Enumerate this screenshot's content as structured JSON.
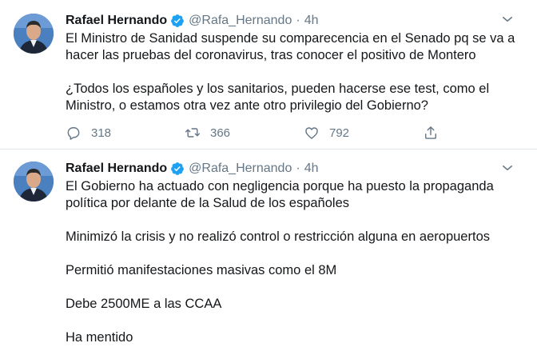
{
  "tweets": [
    {
      "name": "Rafael Hernando",
      "handle": "@Rafa_Hernando",
      "dot": "·",
      "time": "4h",
      "paragraphs": [
        "El Ministro de Sanidad suspende su comparecencia en el Senado pq se va a\nhacer las pruebas del coronavirus, tras conocer el positivo de Montero",
        "¿Todos los españoles y los sanitarios, pueden hacerse ese test, como el\nMinistro, o estamos otra vez ante otro privilegio del Gobierno?"
      ],
      "replies": "318",
      "retweets": "366",
      "likes": "792"
    },
    {
      "name": "Rafael Hernando",
      "handle": "@Rafa_Hernando",
      "dot": "·",
      "time": "4h",
      "paragraphs": [
        "El Gobierno ha actuado con negligencia porque ha puesto la propaganda\npolítica por delante de la Salud de los españoles",
        "Minimizó la crisis y no realizó control o restricción alguna en aeropuertos",
        "Permitió manifestaciones masivas como el 8M",
        "Debe 2500ME a las CCAA",
        "Ha mentido"
      ]
    }
  ],
  "colors": {
    "text": "#14171a",
    "muted": "#657786",
    "verified": "#1da1f2",
    "divider": "#e1e8ed"
  },
  "icons": [
    "verified-badge-icon",
    "chevron-down-icon",
    "reply-icon",
    "retweet-icon",
    "like-icon",
    "share-icon"
  ]
}
